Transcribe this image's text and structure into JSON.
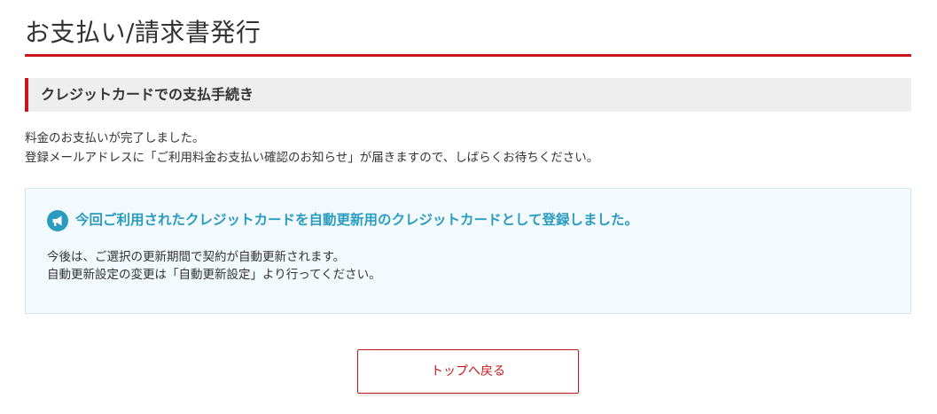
{
  "page": {
    "title": "お支払い/請求書発行"
  },
  "section": {
    "title": "クレジットカードでの支払手続き"
  },
  "message": {
    "line1": "料金のお支払いが完了しました。",
    "line2": "登録メールアドレスに「ご利用料金お支払い確認のお知らせ」が届きますので、しばらくお待ちください。"
  },
  "notice": {
    "icon": "megaphone-icon",
    "heading": "今回ご利用されたクレジットカードを自動更新用のクレジットカードとして登録しました。",
    "line1": "今後は、ご選択の更新期間で契約が自動更新されます。",
    "line2": "自動更新設定の変更は「自動更新設定」より行ってください。"
  },
  "actions": {
    "back_to_top_label": "トップへ戻る"
  },
  "colors": {
    "accent": "#c8161d",
    "notice_text": "#2a9cbf",
    "notice_background": "#f2fafd",
    "section_background": "#eeeeee"
  }
}
